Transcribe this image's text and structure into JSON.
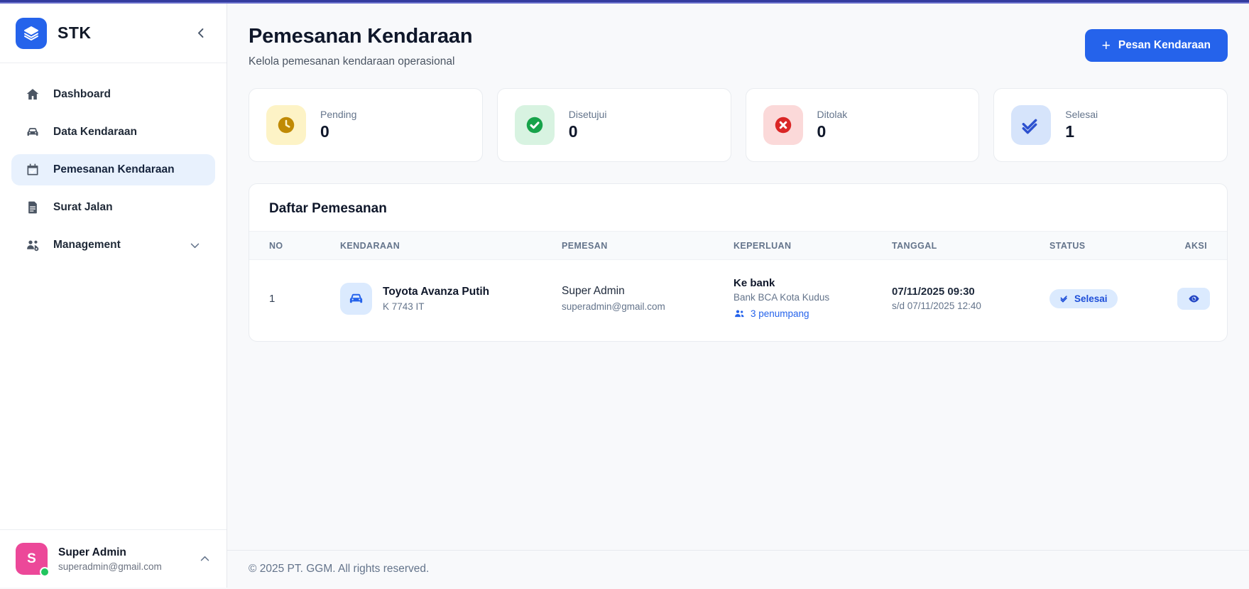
{
  "topbar": {
    "accent_color": "#333b9e"
  },
  "sidebar": {
    "logo_text": "STK",
    "items": [
      {
        "label": "Dashboard",
        "icon": "home-icon",
        "active": false
      },
      {
        "label": "Data Kendaraan",
        "icon": "car-icon",
        "active": false
      },
      {
        "label": "Pemesanan Kendaraan",
        "icon": "calendar-check-icon",
        "active": true
      },
      {
        "label": "Surat Jalan",
        "icon": "document-icon",
        "active": false
      },
      {
        "label": "Management",
        "icon": "users-gear-icon",
        "active": false,
        "has_submenu": true
      }
    ],
    "user": {
      "initial": "S",
      "name": "Super Admin",
      "email": "superadmin@gmail.com",
      "status": "online"
    }
  },
  "header": {
    "title": "Pemesanan Kendaraan",
    "subtitle": "Kelola pemesanan kendaraan operasional",
    "action_button_label": "Pesan Kendaraan",
    "action_button_plus": "+"
  },
  "stats": [
    {
      "label": "Pending",
      "value": "0",
      "icon": "clock-icon",
      "icon_bg": "#fdf3c6",
      "icon_color": "#c08a04"
    },
    {
      "label": "Disetujui",
      "value": "0",
      "icon": "check-circle-icon",
      "icon_bg": "#d8f3e1",
      "icon_color": "#17a34a"
    },
    {
      "label": "Ditolak",
      "value": "0",
      "icon": "x-circle-icon",
      "icon_bg": "#fbd9d9",
      "icon_color": "#da2626"
    },
    {
      "label": "Selesai",
      "value": "1",
      "icon": "double-check-icon",
      "icon_bg": "#d6e4fb",
      "icon_color": "#2d51cf"
    }
  ],
  "table": {
    "title": "Daftar Pemesanan",
    "columns": [
      "NO",
      "KENDARAAN",
      "PEMESAN",
      "KEPERLUAN",
      "TANGGAL",
      "STATUS",
      "AKSI"
    ],
    "rows": [
      {
        "no": "1",
        "vehicle_name": "Toyota Avanza Putih",
        "vehicle_plate": "K 7743 IT",
        "requester_name": "Super Admin",
        "requester_email": "superadmin@gmail.com",
        "purpose": "Ke bank",
        "destination": "Bank BCA Kota Kudus",
        "passengers": "3 penumpang",
        "date_start": "07/11/2025 09:30",
        "date_end": "s/d 07/11/2025 12:40",
        "status": "Selesai"
      }
    ]
  },
  "footer": {
    "copyright": "© 2025 PT. GGM. All rights reserved."
  },
  "colors": {
    "primary": "#2563eb",
    "badge_bg": "#dbeafe",
    "badge_text": "#1d4ed8",
    "avatar": "#ec4899",
    "online": "#22c55e"
  }
}
